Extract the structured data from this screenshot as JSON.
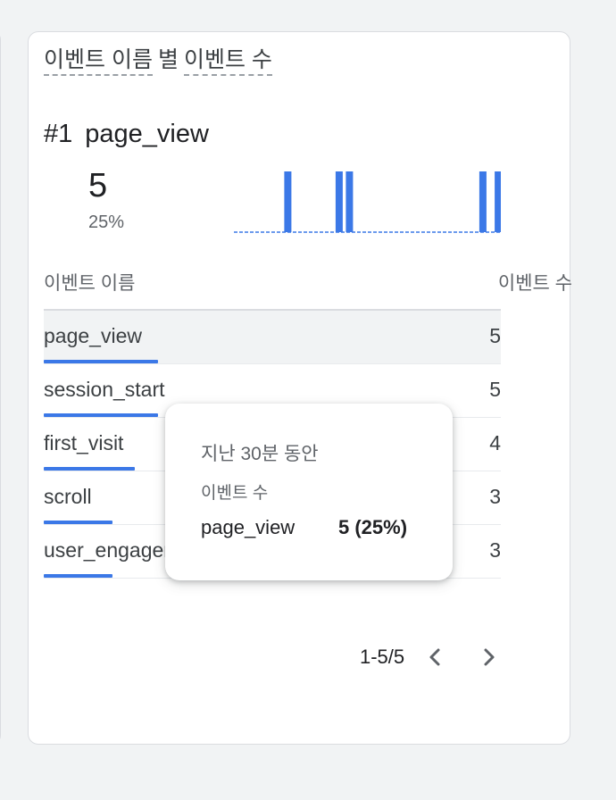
{
  "card": {
    "title_dimension": "이벤트 이름",
    "title_separator": "별",
    "title_metric": "이벤트 수"
  },
  "top_item": {
    "rank": "#1",
    "name": "page_view",
    "value": "5",
    "percent": "25%"
  },
  "sparkline": {
    "bar_color": "#3b78e7",
    "bars": [
      0,
      0,
      0,
      0,
      0,
      0,
      0,
      0,
      0,
      0,
      1,
      0,
      0,
      0,
      0,
      0,
      0,
      0,
      0,
      0,
      1,
      0,
      1,
      0,
      0,
      0,
      0,
      0,
      0,
      0,
      0,
      0,
      0,
      0,
      0,
      0,
      0,
      0,
      0,
      0,
      0,
      0,
      0,
      0,
      0,
      0,
      0,
      0,
      1,
      0,
      0,
      1
    ]
  },
  "table": {
    "columns": {
      "name": "이벤트 이름",
      "count": "이벤트 수"
    },
    "rows": [
      {
        "name": "page_view",
        "count": "5",
        "share": 0.25
      },
      {
        "name": "session_start",
        "count": "5",
        "share": 0.25
      },
      {
        "name": "first_visit",
        "count": "4",
        "share": 0.2
      },
      {
        "name": "scroll",
        "count": "3",
        "share": 0.15
      },
      {
        "name": "user_engagement",
        "count": "3",
        "share": 0.15
      }
    ]
  },
  "tooltip": {
    "period": "지난 30분 동안",
    "metric": "이벤트 수",
    "name": "page_view",
    "value": "5 (25%)"
  },
  "pagination": {
    "label": "1-5/5",
    "prev_icon": "chevron-left-icon",
    "next_icon": "chevron-right-icon"
  }
}
